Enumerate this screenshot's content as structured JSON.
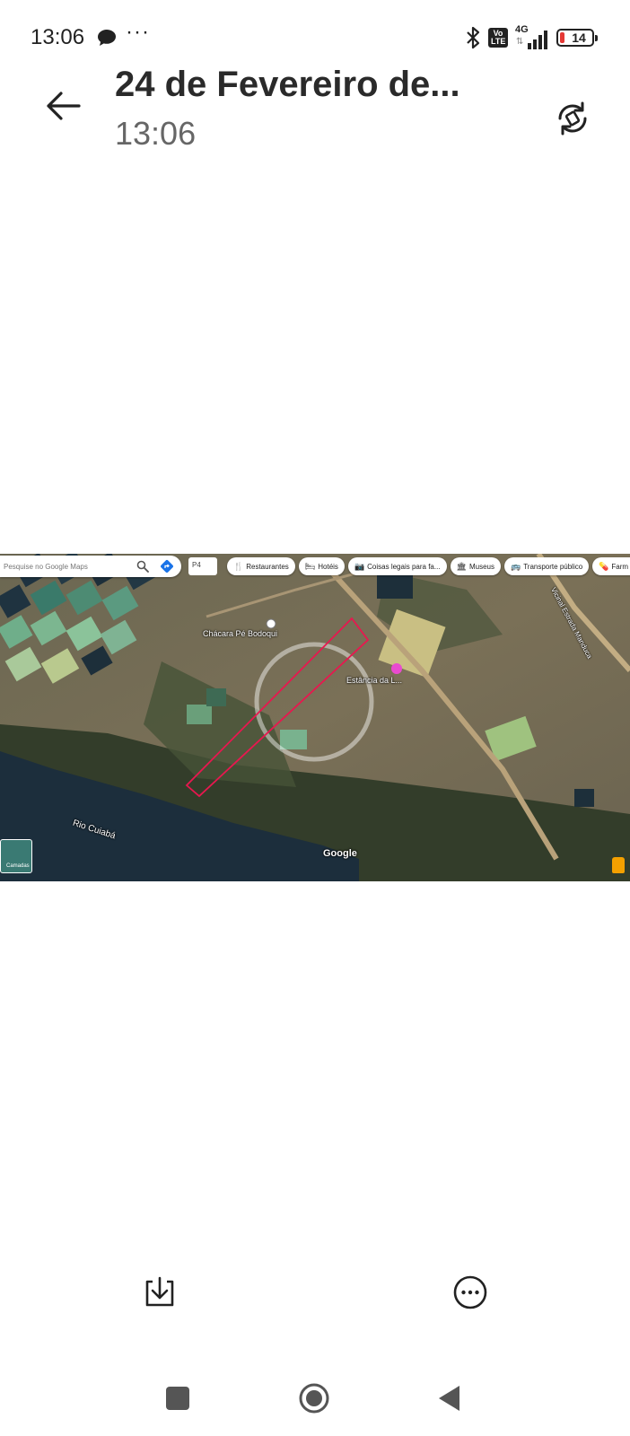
{
  "status_bar": {
    "time": "13:06",
    "message_icon": "chat-bubble-icon",
    "overflow": "···",
    "volte_label": "Vo LTE",
    "network_type": "4G",
    "battery_level": "14"
  },
  "header": {
    "title": "24 de Fevereiro de...",
    "subtitle": "13:06",
    "back_icon": "arrow-left-icon",
    "rotate_icon": "rotate-screen-icon"
  },
  "map": {
    "search_placeholder": "Pesquise no Google Maps",
    "p4_label": "P4",
    "chips": [
      {
        "icon": "🍴",
        "label": "Restaurantes"
      },
      {
        "icon": "🛏",
        "label": "Hotéis"
      },
      {
        "icon": "📷",
        "label": "Coisas legais para fa..."
      },
      {
        "icon": "🏛",
        "label": "Museus"
      },
      {
        "icon": "🚌",
        "label": "Transporte público"
      },
      {
        "icon": "💊",
        "label": "Farm"
      }
    ],
    "place_chacara": "Chácara Pé Bodoqui",
    "place_estancia": "Estância da L...",
    "river_label": "Rio Cuiabá",
    "road_label": "Vicinal Estrada Manduca",
    "attribution": "Google",
    "layers_label": "Camadas",
    "colors": {
      "boundary": "#e8174f",
      "water": "#1c2e3c",
      "forest": "#3a4530"
    }
  },
  "actions": {
    "download_icon": "download-icon",
    "more_icon": "more-options-icon"
  },
  "nav": {
    "recent_icon": "recent-apps-icon",
    "home_icon": "home-icon",
    "back_icon": "back-triangle-icon"
  }
}
